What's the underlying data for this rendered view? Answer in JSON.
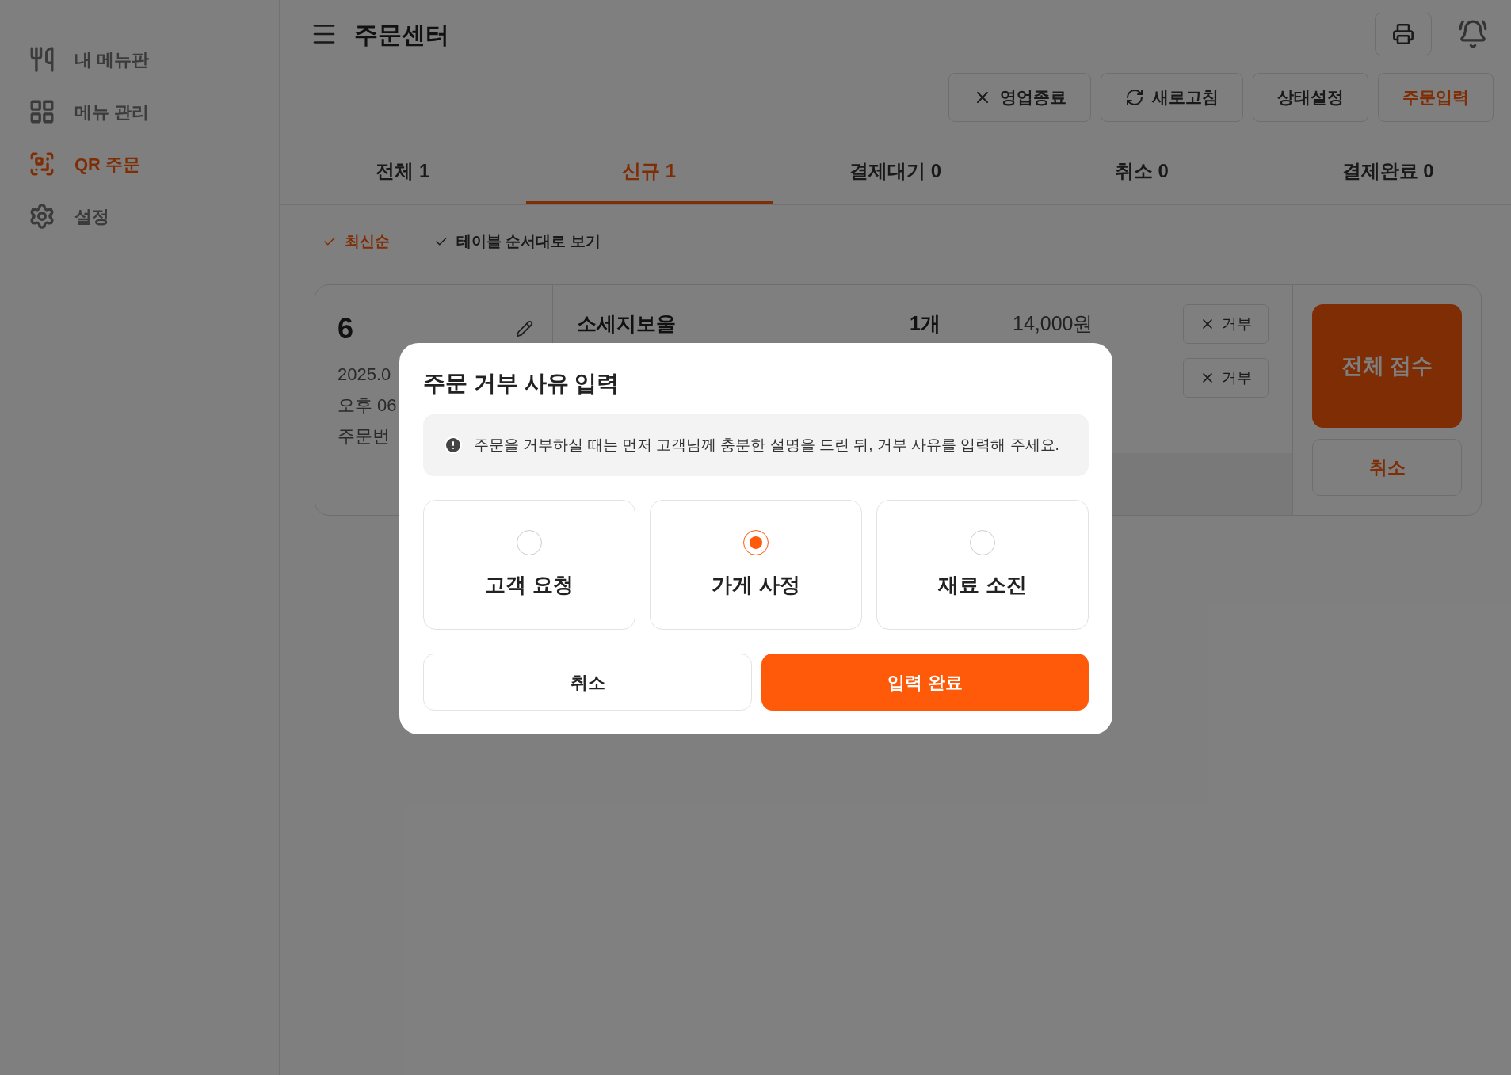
{
  "sidebar": {
    "items": [
      {
        "label": "내 메뉴판",
        "kind": "utensils",
        "selected": false
      },
      {
        "label": "메뉴 관리",
        "kind": "grid",
        "selected": false
      },
      {
        "label": "QR 주문",
        "kind": "qr",
        "selected": true
      },
      {
        "label": "설정",
        "kind": "gear",
        "selected": false
      }
    ]
  },
  "header": {
    "title": "주문센터",
    "actions": [
      {
        "label": "영업종료",
        "kind": "close"
      },
      {
        "label": "새로고침",
        "kind": "refresh"
      },
      {
        "label": "상태설정",
        "kind": "plain"
      },
      {
        "label": "주문입력",
        "kind": "primary"
      }
    ]
  },
  "tabs": [
    {
      "label": "전체 1",
      "selected": false
    },
    {
      "label": "신규 1",
      "selected": true
    },
    {
      "label": "결제대기 0",
      "selected": false
    },
    {
      "label": "취소 0",
      "selected": false
    },
    {
      "label": "결제완료 0",
      "selected": false
    }
  ],
  "filters": [
    {
      "label": "최신순",
      "selected": true
    },
    {
      "label": "테이블 순서대로 보기",
      "selected": false
    }
  ],
  "order_card": {
    "table": "6",
    "date": "2025.0",
    "time": "오후 06",
    "order_no": "주문번",
    "items": [
      {
        "name": "소세지보울",
        "qty": "1개",
        "price": "14,000원",
        "reject": "거부"
      },
      {
        "reject": "거부"
      }
    ],
    "accept_button": "전체 접수",
    "cancel_button": "취소"
  },
  "modal": {
    "title": "주문 거부 사유 입력",
    "notice": "주문을 거부하실 때는 먼저 고객님께 충분한 설명을 드린 뒤, 거부 사유를 입력해 주세요.",
    "options": [
      {
        "label": "고객 요청",
        "selected": false
      },
      {
        "label": "가게 사정",
        "selected": true
      },
      {
        "label": "재료 소진",
        "selected": false
      }
    ],
    "cancel_button": "취소",
    "confirm_button": "입력 완료"
  }
}
